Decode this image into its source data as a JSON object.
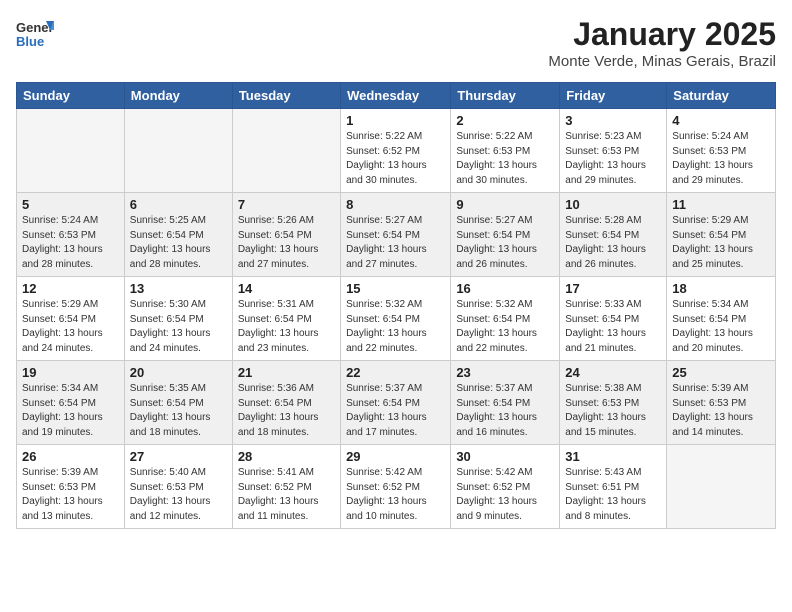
{
  "header": {
    "logo": {
      "line1": "General",
      "line2": "Blue"
    },
    "title": "January 2025",
    "location": "Monte Verde, Minas Gerais, Brazil"
  },
  "weekdays": [
    "Sunday",
    "Monday",
    "Tuesday",
    "Wednesday",
    "Thursday",
    "Friday",
    "Saturday"
  ],
  "weeks": [
    [
      {
        "day": "",
        "info": ""
      },
      {
        "day": "",
        "info": ""
      },
      {
        "day": "",
        "info": ""
      },
      {
        "day": "1",
        "info": "Sunrise: 5:22 AM\nSunset: 6:52 PM\nDaylight: 13 hours\nand 30 minutes."
      },
      {
        "day": "2",
        "info": "Sunrise: 5:22 AM\nSunset: 6:53 PM\nDaylight: 13 hours\nand 30 minutes."
      },
      {
        "day": "3",
        "info": "Sunrise: 5:23 AM\nSunset: 6:53 PM\nDaylight: 13 hours\nand 29 minutes."
      },
      {
        "day": "4",
        "info": "Sunrise: 5:24 AM\nSunset: 6:53 PM\nDaylight: 13 hours\nand 29 minutes."
      }
    ],
    [
      {
        "day": "5",
        "info": "Sunrise: 5:24 AM\nSunset: 6:53 PM\nDaylight: 13 hours\nand 28 minutes."
      },
      {
        "day": "6",
        "info": "Sunrise: 5:25 AM\nSunset: 6:54 PM\nDaylight: 13 hours\nand 28 minutes."
      },
      {
        "day": "7",
        "info": "Sunrise: 5:26 AM\nSunset: 6:54 PM\nDaylight: 13 hours\nand 27 minutes."
      },
      {
        "day": "8",
        "info": "Sunrise: 5:27 AM\nSunset: 6:54 PM\nDaylight: 13 hours\nand 27 minutes."
      },
      {
        "day": "9",
        "info": "Sunrise: 5:27 AM\nSunset: 6:54 PM\nDaylight: 13 hours\nand 26 minutes."
      },
      {
        "day": "10",
        "info": "Sunrise: 5:28 AM\nSunset: 6:54 PM\nDaylight: 13 hours\nand 26 minutes."
      },
      {
        "day": "11",
        "info": "Sunrise: 5:29 AM\nSunset: 6:54 PM\nDaylight: 13 hours\nand 25 minutes."
      }
    ],
    [
      {
        "day": "12",
        "info": "Sunrise: 5:29 AM\nSunset: 6:54 PM\nDaylight: 13 hours\nand 24 minutes."
      },
      {
        "day": "13",
        "info": "Sunrise: 5:30 AM\nSunset: 6:54 PM\nDaylight: 13 hours\nand 24 minutes."
      },
      {
        "day": "14",
        "info": "Sunrise: 5:31 AM\nSunset: 6:54 PM\nDaylight: 13 hours\nand 23 minutes."
      },
      {
        "day": "15",
        "info": "Sunrise: 5:32 AM\nSunset: 6:54 PM\nDaylight: 13 hours\nand 22 minutes."
      },
      {
        "day": "16",
        "info": "Sunrise: 5:32 AM\nSunset: 6:54 PM\nDaylight: 13 hours\nand 22 minutes."
      },
      {
        "day": "17",
        "info": "Sunrise: 5:33 AM\nSunset: 6:54 PM\nDaylight: 13 hours\nand 21 minutes."
      },
      {
        "day": "18",
        "info": "Sunrise: 5:34 AM\nSunset: 6:54 PM\nDaylight: 13 hours\nand 20 minutes."
      }
    ],
    [
      {
        "day": "19",
        "info": "Sunrise: 5:34 AM\nSunset: 6:54 PM\nDaylight: 13 hours\nand 19 minutes."
      },
      {
        "day": "20",
        "info": "Sunrise: 5:35 AM\nSunset: 6:54 PM\nDaylight: 13 hours\nand 18 minutes."
      },
      {
        "day": "21",
        "info": "Sunrise: 5:36 AM\nSunset: 6:54 PM\nDaylight: 13 hours\nand 18 minutes."
      },
      {
        "day": "22",
        "info": "Sunrise: 5:37 AM\nSunset: 6:54 PM\nDaylight: 13 hours\nand 17 minutes."
      },
      {
        "day": "23",
        "info": "Sunrise: 5:37 AM\nSunset: 6:54 PM\nDaylight: 13 hours\nand 16 minutes."
      },
      {
        "day": "24",
        "info": "Sunrise: 5:38 AM\nSunset: 6:53 PM\nDaylight: 13 hours\nand 15 minutes."
      },
      {
        "day": "25",
        "info": "Sunrise: 5:39 AM\nSunset: 6:53 PM\nDaylight: 13 hours\nand 14 minutes."
      }
    ],
    [
      {
        "day": "26",
        "info": "Sunrise: 5:39 AM\nSunset: 6:53 PM\nDaylight: 13 hours\nand 13 minutes."
      },
      {
        "day": "27",
        "info": "Sunrise: 5:40 AM\nSunset: 6:53 PM\nDaylight: 13 hours\nand 12 minutes."
      },
      {
        "day": "28",
        "info": "Sunrise: 5:41 AM\nSunset: 6:52 PM\nDaylight: 13 hours\nand 11 minutes."
      },
      {
        "day": "29",
        "info": "Sunrise: 5:42 AM\nSunset: 6:52 PM\nDaylight: 13 hours\nand 10 minutes."
      },
      {
        "day": "30",
        "info": "Sunrise: 5:42 AM\nSunset: 6:52 PM\nDaylight: 13 hours\nand 9 minutes."
      },
      {
        "day": "31",
        "info": "Sunrise: 5:43 AM\nSunset: 6:51 PM\nDaylight: 13 hours\nand 8 minutes."
      },
      {
        "day": "",
        "info": ""
      }
    ]
  ]
}
